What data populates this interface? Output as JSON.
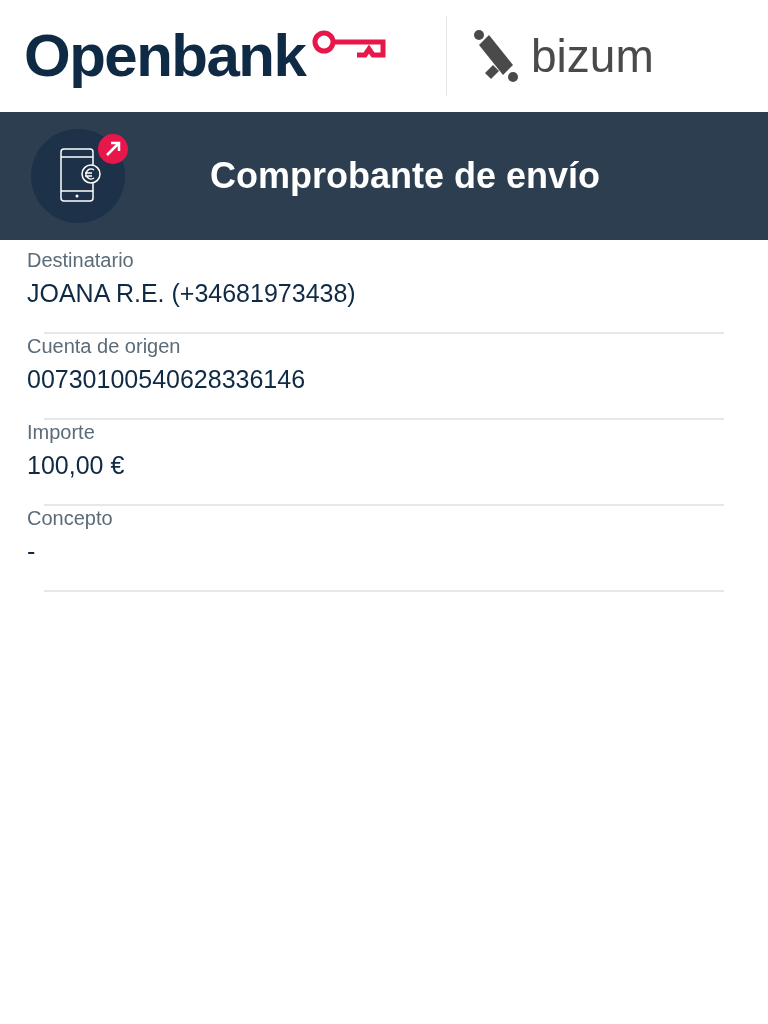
{
  "header": {
    "brand": "Openbank",
    "partner": "bizum"
  },
  "banner": {
    "title": "Comprobante de envío"
  },
  "fields": [
    {
      "label": "Destinatario",
      "value": "JOANA R.E. (+34681973438)"
    },
    {
      "label": "Cuenta de origen",
      "value": "00730100540628336146"
    },
    {
      "label": "Importe",
      "value": "100,00 €"
    },
    {
      "label": "Concepto",
      "value": "-"
    }
  ]
}
